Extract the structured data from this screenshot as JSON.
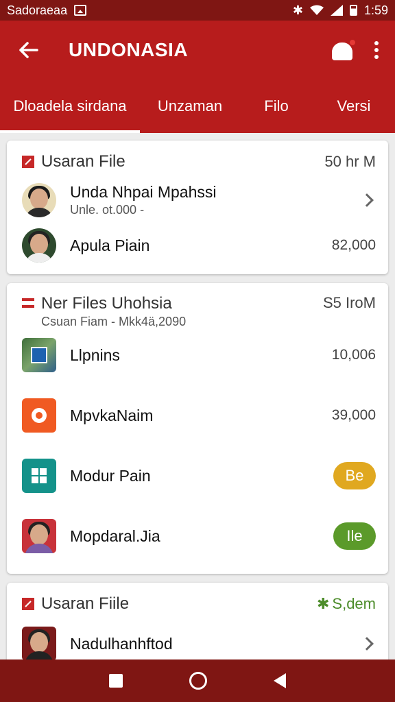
{
  "status_bar": {
    "left_text": "Sadoraeaa",
    "time": "1:59"
  },
  "app_bar": {
    "title": "UNDONASIA"
  },
  "tabs": [
    {
      "label": "Dloadela sirdana",
      "active": true
    },
    {
      "label": "Unzaman",
      "active": false
    },
    {
      "label": "Filo",
      "active": false
    },
    {
      "label": "Versi",
      "active": false
    }
  ],
  "card1": {
    "title": "Usaran File",
    "meta": "50 hr M",
    "rows": [
      {
        "name": "Unda Nhpai Mpahssi",
        "sub": "Unle. ot.000 -"
      },
      {
        "name": "Apula Piain",
        "value": "82,000"
      }
    ]
  },
  "card2": {
    "title": "Ner Files Uhohsia",
    "subtitle": "Csuan Fiam - Mkk4ä,2090",
    "meta": "S5 IroM",
    "rows": [
      {
        "name": "Llpnins",
        "value": "10,006"
      },
      {
        "name": "MpvkaNaim",
        "value": "39,000"
      },
      {
        "name": "Modur Pain",
        "badge": "Be"
      },
      {
        "name": "Mopdaral.Jia",
        "badge": "Ile"
      }
    ]
  },
  "card3": {
    "title": "Usaran Fiile",
    "meta": "S,dem",
    "rows": [
      {
        "name": "Nadulhanhftod"
      }
    ]
  },
  "colors": {
    "primary": "#b71c1c",
    "primary_dark": "#7f1613",
    "badge_yellow": "#e0a820",
    "badge_green": "#5b9a2a",
    "meta_green": "#4c8c2a"
  }
}
